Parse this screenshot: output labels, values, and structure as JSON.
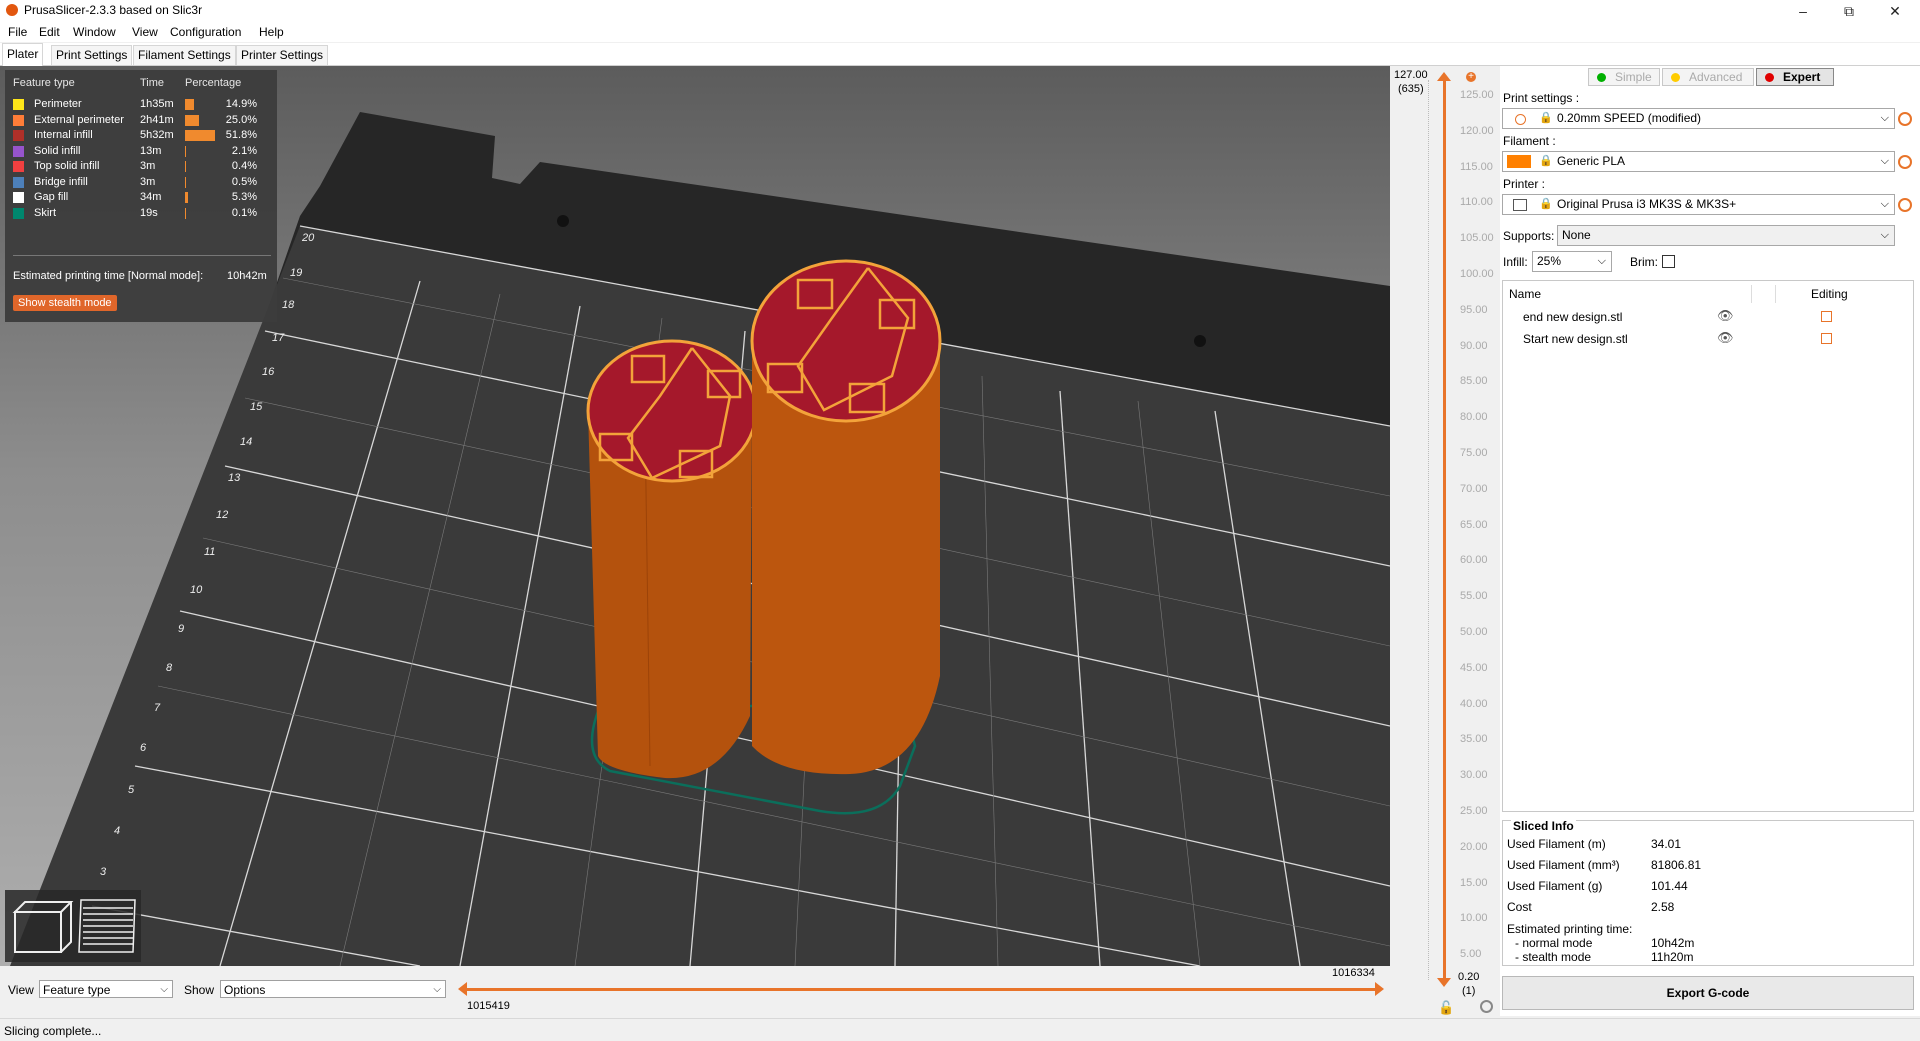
{
  "window": {
    "title": "PrusaSlicer-2.3.3 based on Slic3r"
  },
  "menu": [
    "File",
    "Edit",
    "Window",
    "View",
    "Configuration",
    "Help"
  ],
  "tabs": [
    "Plater",
    "Print Settings",
    "Filament Settings",
    "Printer Settings"
  ],
  "legend": {
    "headers": {
      "type": "Feature type",
      "time": "Time",
      "pct": "Percentage"
    },
    "rows": [
      {
        "name": "Perimeter",
        "time": "1h35m",
        "pct": "14.9%",
        "value": 14.9,
        "color": "#ffe619"
      },
      {
        "name": "External perimeter",
        "time": "2h41m",
        "pct": "25.0%",
        "value": 25.0,
        "color": "#ff7d38"
      },
      {
        "name": "Internal infill",
        "time": "5h32m",
        "pct": "51.8%",
        "value": 51.8,
        "color": "#b03029"
      },
      {
        "name": "Solid infill",
        "time": "13m",
        "pct": "2.1%",
        "value": 2.1,
        "color": "#9654cc"
      },
      {
        "name": "Top solid infill",
        "time": "3m",
        "pct": "0.4%",
        "value": 0.4,
        "color": "#f04040"
      },
      {
        "name": "Bridge infill",
        "time": "3m",
        "pct": "0.5%",
        "value": 0.5,
        "color": "#4d80ba"
      },
      {
        "name": "Gap fill",
        "time": "34m",
        "pct": "5.3%",
        "value": 5.3,
        "color": "#ffffff"
      },
      {
        "name": "Skirt",
        "time": "19s",
        "pct": "0.1%",
        "value": 0.1,
        "color": "#00876e"
      }
    ],
    "estimated_label": "Estimated printing time [Normal mode]:",
    "estimated_value": "10h42m",
    "stealth_button": "Show stealth mode"
  },
  "bed": {
    "row_numbers": [
      "20",
      "19",
      "18",
      "17",
      "16",
      "15",
      "14",
      "13",
      "12",
      "11",
      "10",
      "9",
      "8",
      "7",
      "6",
      "5",
      "4",
      "3"
    ]
  },
  "bottom": {
    "view_label": "View",
    "view_value": "Feature type",
    "show_label": "Show",
    "show_value": "Options",
    "slider_min": "1015419",
    "slider_max": "1016334"
  },
  "vertical_slider": {
    "top_value": "127.00",
    "top_layer": "(635)",
    "bottom_value": "0.20",
    "bottom_layer": "(1)",
    "ticks": [
      "125.00",
      "120.00",
      "115.00",
      "110.00",
      "105.00",
      "100.00",
      "95.00",
      "90.00",
      "85.00",
      "80.00",
      "75.00",
      "70.00",
      "65.00",
      "60.00",
      "55.00",
      "50.00",
      "45.00",
      "40.00",
      "35.00",
      "30.00",
      "25.00",
      "20.00",
      "15.00",
      "10.00",
      "5.00"
    ]
  },
  "modes": {
    "simple": "Simple",
    "advanced": "Advanced",
    "expert": "Expert"
  },
  "settings": {
    "print_label": "Print settings :",
    "print_value": "0.20mm SPEED (modified)",
    "filament_label": "Filament :",
    "filament_value": "Generic PLA",
    "filament_color": "#ff8000",
    "printer_label": "Printer :",
    "printer_value": "Original Prusa i3 MK3S & MK3S+",
    "supports_label": "Supports:",
    "supports_value": "None",
    "infill_label": "Infill:",
    "infill_value": "25%",
    "brim_label": "Brim:"
  },
  "objects": {
    "col_name": "Name",
    "col_editing": "Editing",
    "items": [
      "end new design.stl",
      "Start new design.stl"
    ]
  },
  "sliced_info": {
    "title": "Sliced Info",
    "rows": [
      {
        "label": "Used Filament (m)",
        "value": "34.01"
      },
      {
        "label": "Used Filament (mm³)",
        "value": "81806.81"
      },
      {
        "label": "Used Filament (g)",
        "value": "101.44"
      },
      {
        "label": "Cost",
        "value": "2.58"
      }
    ],
    "est_label": "Estimated printing time:",
    "normal_label": "- normal mode",
    "normal_value": "10h42m",
    "stealth_label": "- stealth mode",
    "stealth_value": "11h20m"
  },
  "export_button": "Export G-code",
  "status": "Slicing complete..."
}
